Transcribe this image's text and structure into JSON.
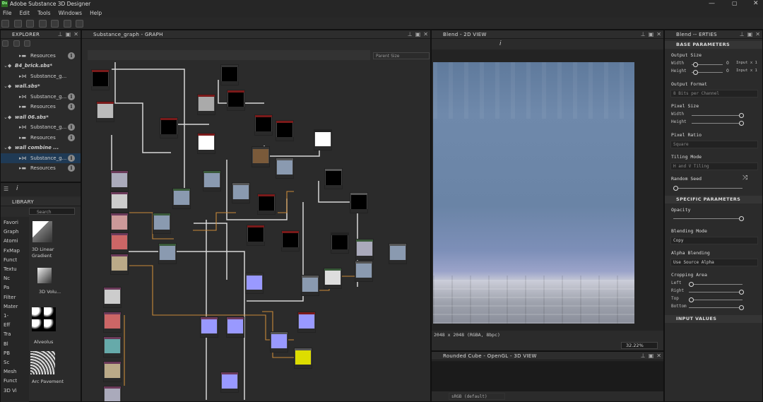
{
  "app": {
    "title": "Adobe Substance 3D Designer",
    "logo": "Ds"
  },
  "menu": [
    "File",
    "Edit",
    "Tools",
    "Windows",
    "Help"
  ],
  "explorer": {
    "title": "EXPLORER",
    "rows": [
      {
        "label": "Resources",
        "type": "folder"
      },
      {
        "label": "B4_brick.sbs*",
        "type": "package"
      },
      {
        "label": "Substance_g...",
        "type": "graph"
      },
      {
        "label": "wall.sbs*",
        "type": "package"
      },
      {
        "label": "Substance_g...",
        "type": "graph"
      },
      {
        "label": "Resources",
        "type": "folder"
      },
      {
        "label": "wall 06.sbs*",
        "type": "package"
      },
      {
        "label": "Substance_g...",
        "type": "graph"
      },
      {
        "label": "Resources",
        "type": "folder"
      },
      {
        "label": "wall combine ...",
        "type": "package"
      },
      {
        "label": "Substance_g...",
        "type": "graph"
      },
      {
        "label": "Resources",
        "type": "folder"
      }
    ]
  },
  "library": {
    "title": "LIBRARY",
    "search_placeholder": "Search",
    "categories": [
      "Favori",
      "Graph",
      "Atomi",
      "FxMap",
      "Funct",
      "Textu",
      "Nc",
      "Pa",
      "Filter",
      "Mater",
      "1-",
      "Eff",
      "Tra",
      "Bl",
      "PB",
      "Sc",
      "Mesh",
      "Funct",
      "3D Vi"
    ],
    "items": [
      "3D Linear Gradient",
      "3D Volu...",
      "Alveolus",
      "Arc Pavement"
    ]
  },
  "graph": {
    "title": "Substance_graph - GRAPH",
    "parent_size_label": "Parent Size"
  },
  "view2d": {
    "title": "Blend - 2D VIEW",
    "resolution": "2048 x 2048 (RGBA, 8bpc)",
    "zoom": "32.22%"
  },
  "view3d": {
    "title": "Rounded Cube - OpenGL - 3D VIEW",
    "colorspace": "sRGB (default)"
  },
  "props": {
    "title": "Blend -- ERTIES",
    "base_section": "BASE PARAMETERS",
    "output_size": "Output Size",
    "width": "Width",
    "height": "Height",
    "width_value": "0",
    "height_value": "0",
    "input_x1": "Input x 1",
    "input_x1b": "Input x 1",
    "output_format": "Output Format",
    "output_format_value": "8 Bits per Channel",
    "pixel_size": "Pixel Size",
    "px_width": "Width",
    "px_height": "Height",
    "pixel_ratio": "Pixel Ratio",
    "pixel_ratio_value": "Square",
    "tiling_mode": "Tiling Mode",
    "tiling_mode_value": "H and V Tiling",
    "random_seed": "Random Seed",
    "specific_section": "SPECIFIC PARAMETERS",
    "opacity": "Opacity",
    "blending_mode": "Blending Mode",
    "blending_mode_value": "Copy",
    "alpha_blending": "Alpha Blending",
    "alpha_blending_value": "Use Source Alpha",
    "cropping_area": "Cropping Area",
    "left": "Left",
    "right": "Right",
    "top": "Top",
    "bottom": "Bottom",
    "input_values": "INPUT VALUES"
  }
}
